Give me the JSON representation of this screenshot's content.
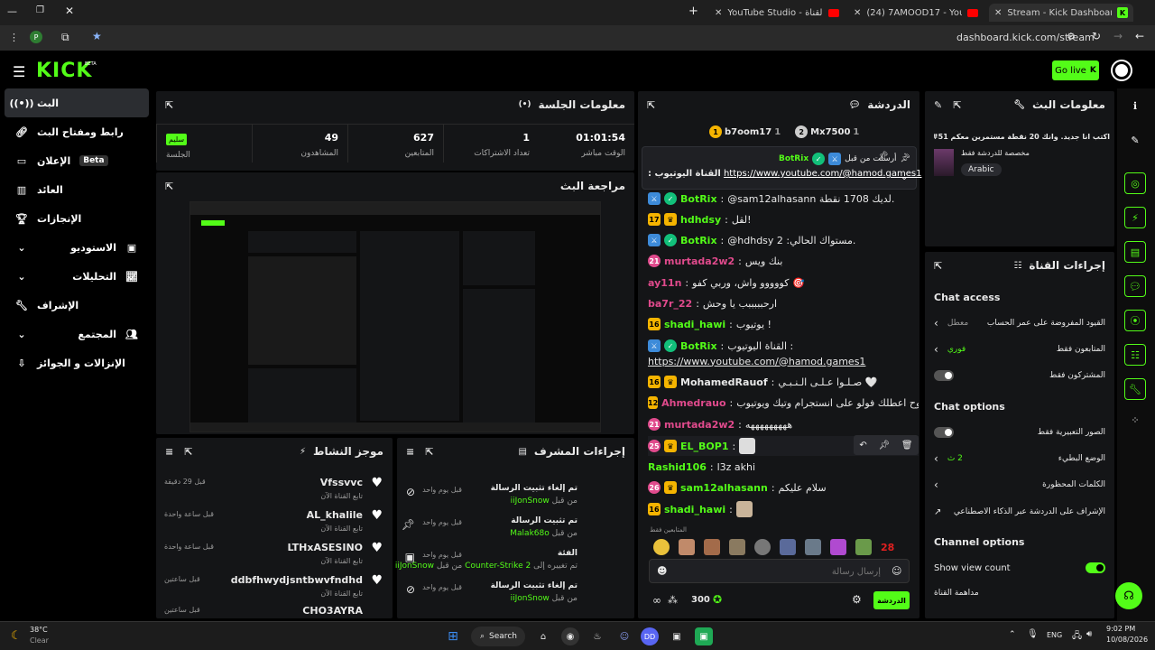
{
  "browser": {
    "tabs": [
      {
        "label": "YouTube Studio - محتوى القناة"
      },
      {
        "label": "(24) 7AMOOD17 - YouTube"
      },
      {
        "label": "Stream - Kick Dashboard"
      }
    ],
    "url": "dashboard.kick.com/stream"
  },
  "topbar": {
    "logo": "KICK",
    "logo_beta": "BETA",
    "go_live": "Go live"
  },
  "sidebar": {
    "items": [
      {
        "label": "البث",
        "icon": "broadcast-icon"
      },
      {
        "label": "رابط ومفتاح البث",
        "icon": "link-icon"
      },
      {
        "label": "الإعلان",
        "badge": "Beta",
        "icon": "ad-icon"
      },
      {
        "label": "العائد",
        "icon": "chart-bars-icon"
      },
      {
        "label": "الإنجازات",
        "icon": "trophy-icon"
      },
      {
        "label": "الاستوديو",
        "icon": "studio-icon"
      },
      {
        "label": "التحليلات",
        "icon": "analytics-icon"
      },
      {
        "label": "الإشراف",
        "icon": "wrench-icon"
      },
      {
        "label": "المجتمع",
        "icon": "community-icon"
      },
      {
        "label": "الإنزالات و الجوائز",
        "icon": "drops-icon"
      }
    ]
  },
  "session": {
    "title": "معلومات الجلسة",
    "status_chip": "سليم",
    "status_label": "الجلسة",
    "stats": [
      {
        "value": "01:01:54",
        "label": "الوقت مباشر"
      },
      {
        "value": "1",
        "label": "تعداد الاشتراكات"
      },
      {
        "value": "627",
        "label": "المتابعين"
      },
      {
        "value": "49",
        "label": "المشاهدون"
      }
    ]
  },
  "preview": {
    "title": "مراجعة البث"
  },
  "activity": {
    "title": "موجز النشاط",
    "items": [
      {
        "name": "Vfssvvc",
        "sub": "تابع القناة الآن",
        "time": "قبل 29 دقيقة"
      },
      {
        "name": "AL_khalile",
        "sub": "تابع القناة الآن",
        "time": "قبل ساعة واحدة"
      },
      {
        "name": "LTHxASESINO",
        "sub": "تابع القناة الآن",
        "time": "قبل ساعة واحدة"
      },
      {
        "name": "ddbfhwydjsntbwvfndhd",
        "sub": "تابع القناة الآن",
        "time": "قبل ساعتين"
      },
      {
        "name": "CHO3AYRA",
        "sub": "",
        "time": "قبل ساعتين"
      }
    ]
  },
  "modactions": {
    "title": "إجراءات المشرف",
    "items": [
      {
        "action": "تم إلغاء تثبيت الرسالة",
        "by_prefix": "من قبل",
        "by": "iiJonSnow",
        "time": "قبل يوم واحد",
        "icon": "unpin-icon"
      },
      {
        "action": "تم تثبيت الرسالة",
        "by_prefix": "من قبل",
        "by": "Malak68o",
        "time": "قبل يوم واحد",
        "icon": "pin-icon"
      },
      {
        "action": "الفئة",
        "by_prefix": "من قبل",
        "by": "iiJonSnow",
        "extra": "Counter-Strike 2",
        "extra_prefix": "تم تغييره إلى",
        "time": "قبل يوم واحد",
        "icon": "category-icon"
      },
      {
        "action": "تم إلغاء تثبيت الرسالة",
        "by_prefix": "من قبل",
        "by": "iiJonSnow",
        "time": "قبل يوم واحد",
        "icon": "unpin-icon"
      }
    ]
  },
  "chat": {
    "title": "الدردشة",
    "top_users": [
      {
        "name": "b7oom17",
        "count": "1"
      },
      {
        "name": "Mx7500",
        "count": "1"
      }
    ],
    "pinned": {
      "label": "أرسلت من قبل",
      "by": "BotRix",
      "text": ": القناة اليوتيوب",
      "link": "https://www.youtube.com/@hamod.games1"
    },
    "messages": [
      {
        "name": "BotRix",
        "color": "#53fc18",
        "badges": [
          "mod",
          "verified"
        ],
        "text": "@sam12alhasann لديك 1708 نقطة."
      },
      {
        "name": "hdhdsy",
        "color": "#53fc18",
        "badges": [
          "17",
          "gold"
        ],
        "text": "لقل!"
      },
      {
        "name": "BotRix",
        "color": "#53fc18",
        "badges": [
          "mod",
          "verified"
        ],
        "text": "@hdhdsy مستواك الحالي: 2."
      },
      {
        "name": "murtada2w2",
        "color": "#e04a8c",
        "badges": [
          "21"
        ],
        "text": "بنك ويس"
      },
      {
        "name": "ay11n",
        "color": "#e04a8c",
        "badges": [],
        "text": "كووووو واش، وربي كفو 🎯"
      },
      {
        "name": "ba7r_22",
        "color": "#e04a8c",
        "badges": [],
        "text": "ارحبببببب يا وحش"
      },
      {
        "name": "shadi_hawi",
        "color": "#53fc18",
        "badges": [
          "16"
        ],
        "text": "يوتيوب !"
      },
      {
        "name": "BotRix",
        "color": "#53fc18",
        "badges": [
          "mod",
          "verified"
        ],
        "text": "القناة اليوتيوب :"
      },
      {
        "name": "",
        "color": "#fff",
        "badges": [],
        "text": "https://www.youtube.com/@hamod.games1"
      },
      {
        "name": "MohamedRauof",
        "color": "#fff",
        "badges": [
          "16",
          "gold"
        ],
        "text": "صـلـوا عـلـى الـنـبـي 🤍"
      },
      {
        "name": "Ahmedrauo",
        "color": "#e04a8c",
        "badges": [
          "12"
        ],
        "text": "بروح اعطلك فولو على انستجرام وتيك ويوتيوب"
      },
      {
        "name": "murtada2w2",
        "color": "#e04a8c",
        "badges": [
          "21"
        ],
        "text": "هههههههههه"
      },
      {
        "name": "EL_BOP1",
        "color": "#53fc18",
        "badges": [
          "25",
          "gold"
        ],
        "text": ""
      },
      {
        "name": "Rashid106",
        "color": "#53fc18",
        "badges": [],
        "text": "l3z akhi"
      },
      {
        "name": "sam12alhasann",
        "color": "#53fc18",
        "badges": [
          "26",
          "gold"
        ],
        "text": "سلام عليكم"
      },
      {
        "name": "shadi_hawi",
        "color": "#53fc18",
        "badges": [
          "16"
        ],
        "text": ""
      }
    ],
    "followers_only": "المتابعين فقط",
    "input_placeholder": "إرسال رسالة",
    "points": "300",
    "send_label": "الدردشة",
    "emote_count": "28"
  },
  "streaminfo": {
    "title": "معلومات البث",
    "stream_title": "اكتب انا جديد. وانك 20 نقطة مستمرين معكم 51#",
    "category": "مخصصة للدردشة فقط",
    "language": "Arabic"
  },
  "channelactions": {
    "title": "إجراءات القناة",
    "chat_access_title": "Chat access",
    "chat_options_title": "Chat options",
    "channel_options_title": "Channel options",
    "rows": [
      {
        "label": "القيود المفروضة على عمر الحساب",
        "value": "معطل",
        "type": "chevron"
      },
      {
        "label": "المتابعون فقط",
        "value": "فوري",
        "type": "chevron"
      },
      {
        "label": "المشتركون فقط",
        "value": "",
        "type": "toggle"
      },
      {
        "label": "الصور التعبيرية فقط",
        "value": "",
        "type": "toggle"
      },
      {
        "label": "الوضع البطيء",
        "value": "2 ث",
        "type": "chevron"
      },
      {
        "label": "الكلمات المحظورة",
        "value": "",
        "type": "chevron"
      },
      {
        "label": "الإشراف على الدردشة عبر الذكاء الاصطناعي",
        "value": "",
        "type": "external"
      }
    ],
    "show_view_count": "Show view count",
    "host_label": "مداهمة القناة"
  },
  "taskbar": {
    "weather_temp": "38°C",
    "weather_desc": "Clear",
    "search": "Search",
    "lang": "ENG",
    "time": "9:02 PM",
    "date": "10/08/2026"
  }
}
